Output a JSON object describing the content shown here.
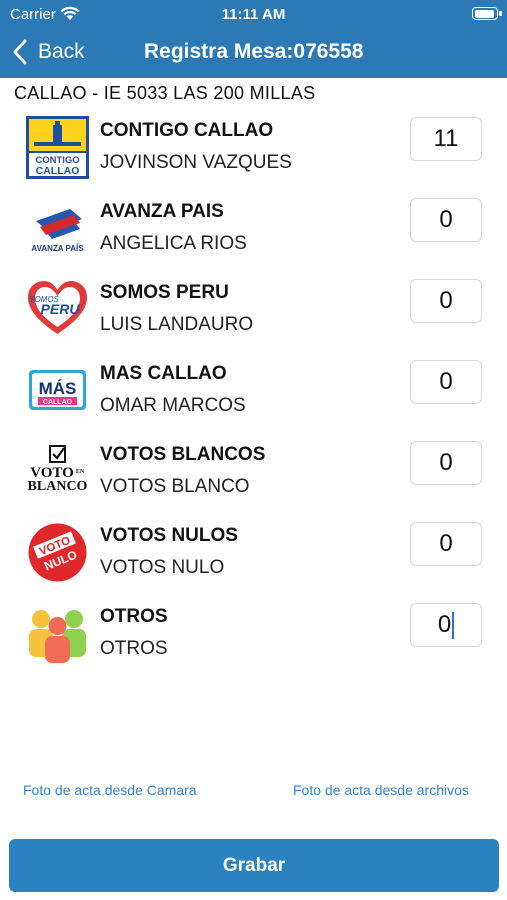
{
  "status_bar": {
    "carrier": "Carrier",
    "time": "11:11 AM"
  },
  "nav": {
    "back_label": "Back",
    "title": "Registra Mesa:076558"
  },
  "location": "CALLAO - IE 5033 LAS 200 MILLAS",
  "rows": [
    {
      "party": "CONTIGO CALLAO",
      "candidate": "JOVINSON VAZQUES",
      "votes": "11",
      "logo": "contigo-callao-logo",
      "logo_text": [
        "CONTIGO",
        "CALLAO"
      ]
    },
    {
      "party": "AVANZA PAIS",
      "candidate": "ANGELICA RIOS",
      "votes": "0",
      "logo": "avanza-pais-logo",
      "logo_text": [
        "AVANZA PAÍS"
      ]
    },
    {
      "party": "SOMOS PERU",
      "candidate": "LUIS LANDAURO",
      "votes": "0",
      "logo": "somos-peru-logo",
      "logo_text": [
        "SOMOS",
        "PERU"
      ]
    },
    {
      "party": "MAS CALLAO",
      "candidate": "OMAR MARCOS",
      "votes": "0",
      "logo": "mas-callao-logo",
      "logo_text": [
        "MÁS",
        "CALLAO"
      ]
    },
    {
      "party": "VOTOS BLANCOS",
      "candidate": "VOTOS BLANCO",
      "votes": "0",
      "logo": "voto-en-blanco-logo",
      "logo_text": [
        "VOTO",
        "EN",
        "BLANCO"
      ]
    },
    {
      "party": "VOTOS NULOS",
      "candidate": "VOTOS NULO",
      "votes": "0",
      "logo": "voto-nulo-logo",
      "logo_text": [
        "VOTO",
        "NULO"
      ]
    },
    {
      "party": "OTROS",
      "candidate": "OTROS",
      "votes": "0",
      "logo": "otros-people-icon"
    }
  ],
  "links": {
    "camera": "Foto de acta desde Camara",
    "files": "Foto de acta desde archivos"
  },
  "save_label": "Grabar",
  "colors": {
    "header": "#2b7ab5",
    "button": "#2b82c1",
    "link": "#2f86d6"
  }
}
